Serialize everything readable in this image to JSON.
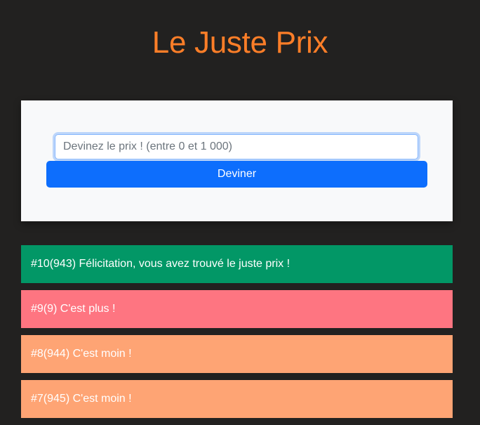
{
  "title": "Le Juste Prix",
  "form": {
    "input_placeholder": "Devinez le prix ! (entre 0 et 1 000)",
    "input_value": "",
    "button_label": "Deviner"
  },
  "results": [
    {
      "text": "#10(943) Félicitation, vous avez trouvé le juste prix !",
      "status": "win"
    },
    {
      "text": "#9(9) C'est plus !",
      "status": "plus"
    },
    {
      "text": "#8(944) C'est moin !",
      "status": "moins"
    },
    {
      "text": "#7(945) C'est moin !",
      "status": "moins"
    }
  ],
  "colors": {
    "background": "#222120",
    "title": "#fd7e28",
    "card": "#f8f9fa",
    "button": "#0d6efd",
    "win": "#029766",
    "plus": "#fe7581",
    "moins": "#fea474"
  }
}
